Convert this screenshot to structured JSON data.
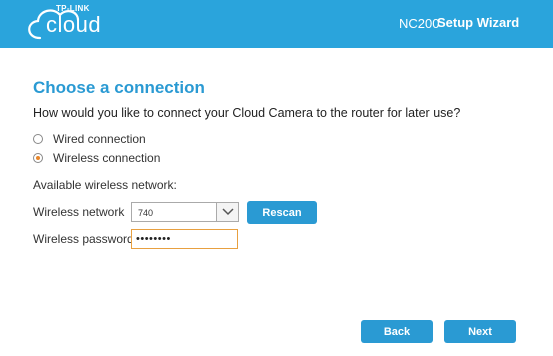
{
  "header": {
    "logo_top": "TP-LINK",
    "logo_main": "cloud",
    "model": "NC200",
    "wizard_title": "Setup Wizard",
    "background": "#2aa4dc"
  },
  "content": {
    "title": "Choose a connection",
    "question": "How would you like to connect your Cloud Camera to the router for later use?",
    "options": [
      {
        "label": "Wired connection",
        "checked": false
      },
      {
        "label": "Wireless connection",
        "checked": true
      }
    ],
    "available_label": "Available wireless network:",
    "network_label": "Wireless network",
    "network_value": "740",
    "rescan_label": "Rescan",
    "password_label": "Wireless password",
    "password_value": "••••••••"
  },
  "footer": {
    "back_label": "Back",
    "next_label": "Next"
  },
  "colors": {
    "accent": "#2a9ad3",
    "radio_selected": "#e8872b",
    "focus_border": "#e8a040"
  }
}
